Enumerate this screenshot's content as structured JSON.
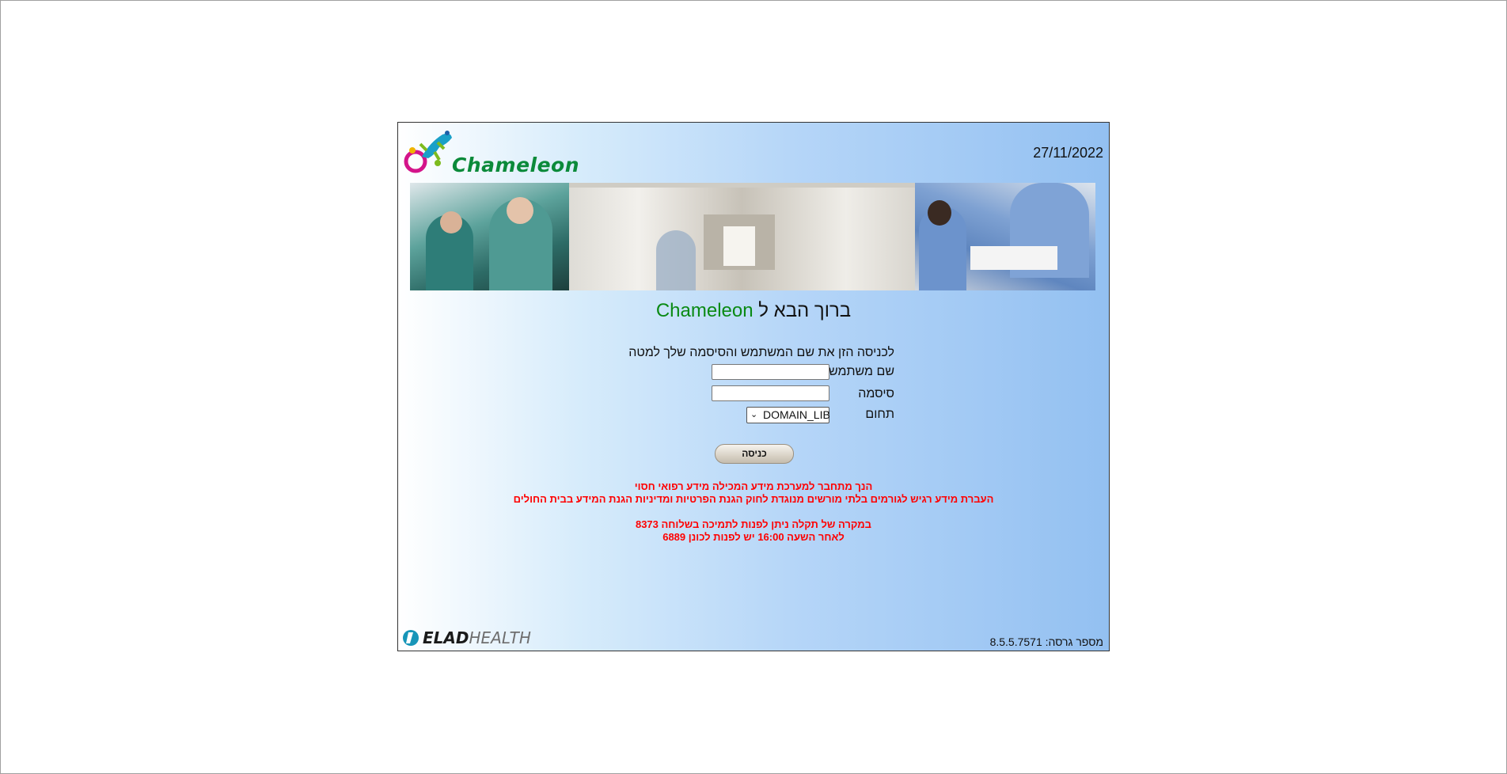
{
  "header": {
    "logo_text": "Chameleon",
    "date": "27/11/2022"
  },
  "welcome": {
    "prefix": "ברוך הבא ל ",
    "brand": "Chameleon"
  },
  "form": {
    "instructions": "לכניסה הזן את שם המשתמש והסיסמה שלך למטה",
    "username_label": "שם משתמש",
    "username_value": "",
    "password_label": "סיסמה",
    "password_value": "",
    "domain_label": "תחום",
    "domain_value": "DOMAIN_LIB",
    "login_button": "כניסה"
  },
  "warnings": {
    "line1": "הנך מתחבר למערכת מידע המכילה מידע רפואי חסוי",
    "line2": "העברת מידע רגיש לגורמים בלתי מורשים מנוגדת לחוק הגנת הפרטיות ומדיניות הגנת המידע בבית החולים",
    "line3": "במקרה של תקלה ניתן לפנות לתמיכה בשלוחה 8373",
    "line4": "לאחר השעה 16:00 יש לפנות לכונן 6889"
  },
  "footer": {
    "logo_main": "ELAD",
    "logo_sub": "HEALTH",
    "version": "מספר גרסה: 8.5.5.7571"
  },
  "colors": {
    "brand_green": "#0a8a14",
    "warning_red": "#ff0000"
  },
  "icons": [
    "chameleon-logo-icon",
    "elad-health-logo-icon",
    "chevron-down-icon"
  ]
}
